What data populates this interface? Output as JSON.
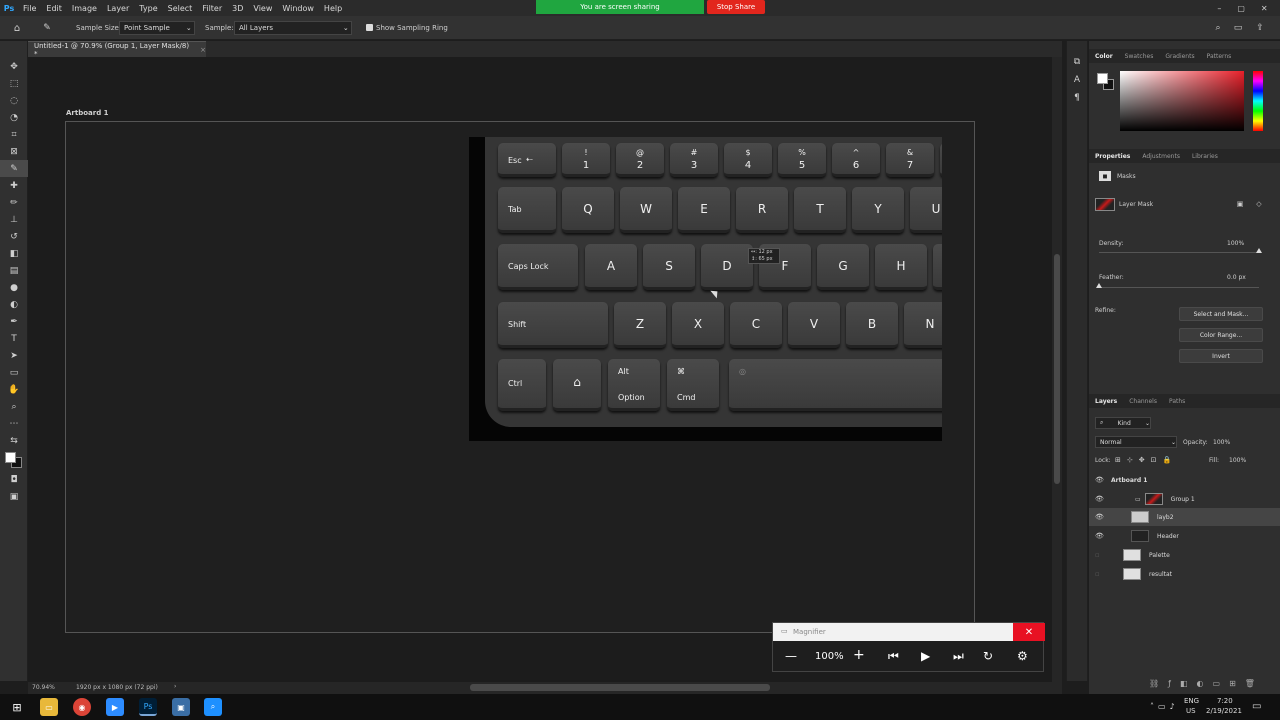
{
  "menubar": {
    "items": [
      "File",
      "Edit",
      "Image",
      "Layer",
      "Type",
      "Select",
      "Filter",
      "3D",
      "View",
      "Window",
      "Help"
    ],
    "logo": "Ps"
  },
  "screen_share": {
    "message": "You are screen sharing",
    "stop_label": "Stop Share"
  },
  "options": {
    "sample_size_label": "Sample Size:",
    "sample_size_value": "Point Sample",
    "sample_label": "Sample:",
    "sample_value": "All Layers",
    "show_ring_label": "Show Sampling Ring"
  },
  "document": {
    "tab_title": "Untitled-1 @ 70.9% (Group 1, Layer Mask/8) *"
  },
  "artboard": {
    "label": "Artboard 1"
  },
  "keyboard": {
    "row1": [
      {
        "top": "Esc",
        "bottom": ""
      },
      {
        "top": "!",
        "bottom": "1"
      },
      {
        "top": "@",
        "bottom": "2"
      },
      {
        "top": "#",
        "bottom": "3"
      },
      {
        "top": "$",
        "bottom": "4"
      },
      {
        "top": "%",
        "bottom": "5"
      },
      {
        "top": "^",
        "bottom": "6"
      },
      {
        "top": "&",
        "bottom": "7"
      }
    ],
    "row2": [
      "Tab",
      "Q",
      "W",
      "E",
      "R",
      "T",
      "Y",
      "U"
    ],
    "row3": [
      "Caps Lock",
      "A",
      "S",
      "D",
      "F",
      "G",
      "H"
    ],
    "row4": [
      "Shift",
      "Z",
      "X",
      "C",
      "V",
      "B",
      "N"
    ],
    "row5": {
      "ctrl": "Ctrl",
      "alt": "Alt",
      "option": "Option",
      "cmd_symbol": "⌘",
      "cmd": "Cmd"
    }
  },
  "measure_tooltip": {
    "w": "12 px",
    "h": "65 px"
  },
  "status": {
    "zoom": "70.94%",
    "doc_size": "1920 px x 1080 px (72 ppi)"
  },
  "color_panel": {
    "tabs": [
      "Color",
      "Swatches",
      "Gradients",
      "Patterns"
    ],
    "accent": "#e8202a"
  },
  "properties_panel": {
    "tabs": [
      "Properties",
      "Adjustments",
      "Libraries"
    ],
    "section": "Masks",
    "mask_label": "Layer Mask",
    "density_label": "Density:",
    "density_value": "100%",
    "feather_label": "Feather:",
    "feather_value": "0.0 px",
    "refine_label": "Refine:",
    "select_mask_btn": "Select and Mask...",
    "color_range_btn": "Color Range...",
    "invert_btn": "Invert"
  },
  "layers_panel": {
    "tabs": [
      "Layers",
      "Channels",
      "Paths"
    ],
    "kind": "Kind",
    "blend_mode": "Normal",
    "opacity_label": "Opacity:",
    "opacity_value": "100%",
    "lock_label": "Lock:",
    "fill_label": "Fill:",
    "fill_value": "100%",
    "layers": [
      "Artboard 1",
      "Group 1",
      "layb2",
      "Header",
      "Palette",
      "resultat"
    ]
  },
  "magnifier": {
    "title": "Magnifier",
    "zoom": "100%"
  },
  "taskbar": {
    "lang1": "ENG",
    "lang2": "US",
    "time": "7:20",
    "date": "2/19/2021"
  }
}
